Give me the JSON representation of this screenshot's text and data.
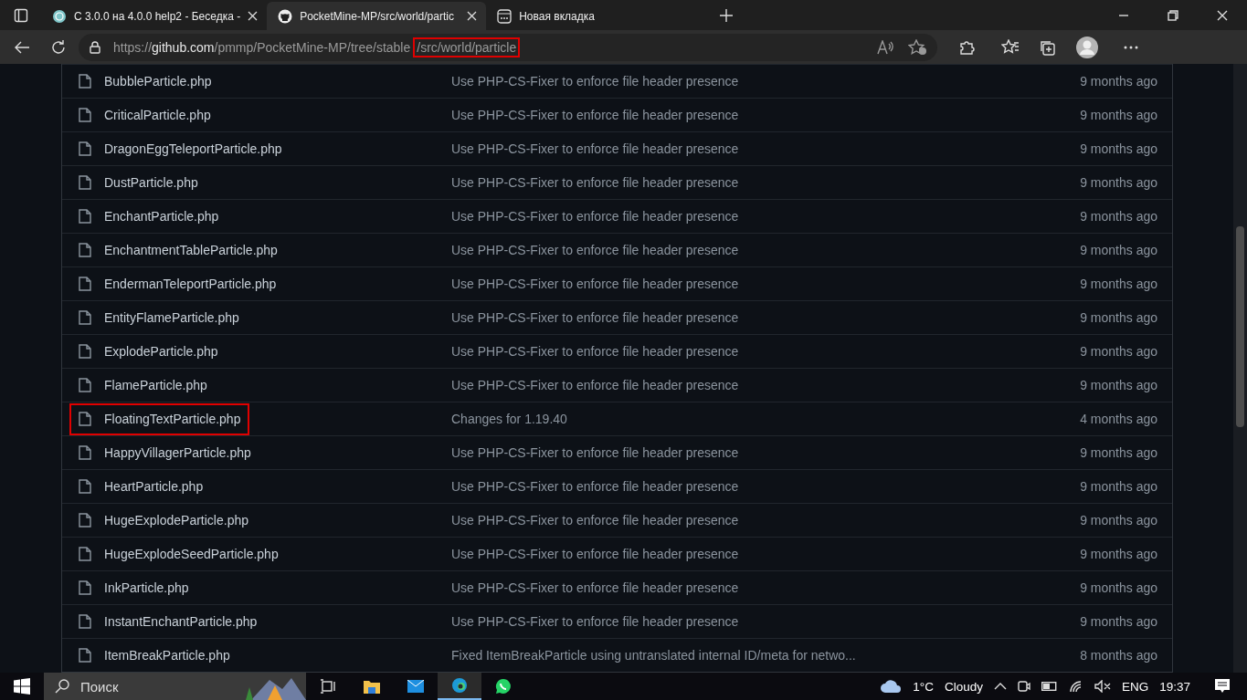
{
  "tabs": [
    {
      "title": "С 3.0.0 на 4.0.0 help2 - Беседка -",
      "selected": false,
      "kind": "forum",
      "closable": true
    },
    {
      "title": "PocketMine-MP/src/world/partic",
      "selected": true,
      "kind": "github",
      "closable": true
    },
    {
      "title": "Новая вкладка",
      "selected": false,
      "kind": "newtab",
      "closable": false
    }
  ],
  "address": {
    "scheme": "https://",
    "host": "github.com",
    "path": "/pmmp/PocketMine-MP/tree/stable",
    "highlighted_path": "/src/world/particle"
  },
  "files": [
    {
      "name": "BubbleParticle.php",
      "message": "Use PHP-CS-Fixer to enforce file header presence",
      "age": "9 months ago",
      "highlighted": false
    },
    {
      "name": "CriticalParticle.php",
      "message": "Use PHP-CS-Fixer to enforce file header presence",
      "age": "9 months ago",
      "highlighted": false
    },
    {
      "name": "DragonEggTeleportParticle.php",
      "message": "Use PHP-CS-Fixer to enforce file header presence",
      "age": "9 months ago",
      "highlighted": false
    },
    {
      "name": "DustParticle.php",
      "message": "Use PHP-CS-Fixer to enforce file header presence",
      "age": "9 months ago",
      "highlighted": false
    },
    {
      "name": "EnchantParticle.php",
      "message": "Use PHP-CS-Fixer to enforce file header presence",
      "age": "9 months ago",
      "highlighted": false
    },
    {
      "name": "EnchantmentTableParticle.php",
      "message": "Use PHP-CS-Fixer to enforce file header presence",
      "age": "9 months ago",
      "highlighted": false
    },
    {
      "name": "EndermanTeleportParticle.php",
      "message": "Use PHP-CS-Fixer to enforce file header presence",
      "age": "9 months ago",
      "highlighted": false
    },
    {
      "name": "EntityFlameParticle.php",
      "message": "Use PHP-CS-Fixer to enforce file header presence",
      "age": "9 months ago",
      "highlighted": false
    },
    {
      "name": "ExplodeParticle.php",
      "message": "Use PHP-CS-Fixer to enforce file header presence",
      "age": "9 months ago",
      "highlighted": false
    },
    {
      "name": "FlameParticle.php",
      "message": "Use PHP-CS-Fixer to enforce file header presence",
      "age": "9 months ago",
      "highlighted": false
    },
    {
      "name": "FloatingTextParticle.php",
      "message": "Changes for 1.19.40",
      "age": "4 months ago",
      "highlighted": true
    },
    {
      "name": "HappyVillagerParticle.php",
      "message": "Use PHP-CS-Fixer to enforce file header presence",
      "age": "9 months ago",
      "highlighted": false
    },
    {
      "name": "HeartParticle.php",
      "message": "Use PHP-CS-Fixer to enforce file header presence",
      "age": "9 months ago",
      "highlighted": false
    },
    {
      "name": "HugeExplodeParticle.php",
      "message": "Use PHP-CS-Fixer to enforce file header presence",
      "age": "9 months ago",
      "highlighted": false
    },
    {
      "name": "HugeExplodeSeedParticle.php",
      "message": "Use PHP-CS-Fixer to enforce file header presence",
      "age": "9 months ago",
      "highlighted": false
    },
    {
      "name": "InkParticle.php",
      "message": "Use PHP-CS-Fixer to enforce file header presence",
      "age": "9 months ago",
      "highlighted": false
    },
    {
      "name": "InstantEnchantParticle.php",
      "message": "Use PHP-CS-Fixer to enforce file header presence",
      "age": "9 months ago",
      "highlighted": false
    },
    {
      "name": "ItemBreakParticle.php",
      "message": "Fixed ItemBreakParticle using untranslated internal ID/meta for netwo...",
      "age": "8 months ago",
      "highlighted": false
    }
  ],
  "taskbar": {
    "search_placeholder": "Поиск",
    "weather": {
      "temperature": "1°C",
      "condition": "Cloudy"
    },
    "language": "ENG",
    "time": "19:37"
  }
}
